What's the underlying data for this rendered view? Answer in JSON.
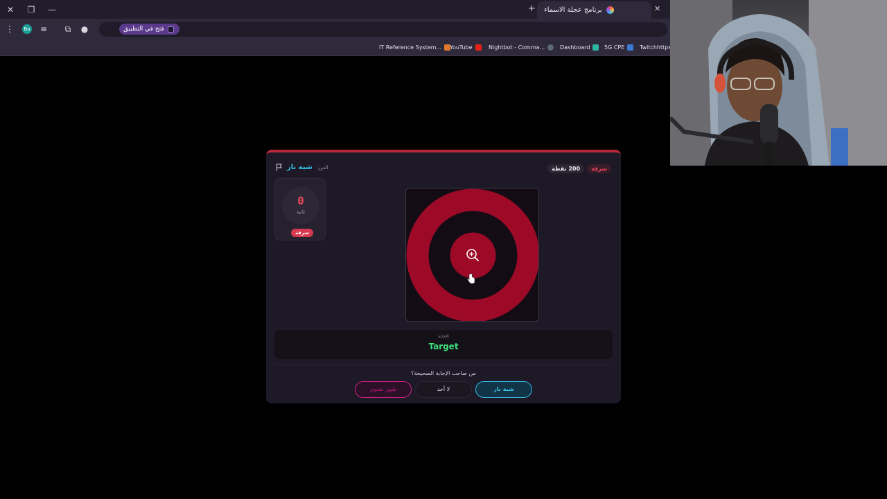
{
  "browser": {
    "tab_title": "برنامج عجلة الاسماء",
    "open_in_app_label": "فتح في التطبيق",
    "profile_initials": "Ba",
    "bookmarks": [
      {
        "label": "IT Reference System...",
        "color": "#e07a2e"
      },
      {
        "label": "YouTube",
        "color": "#e62117"
      },
      {
        "label": "Nightbot - Comma...",
        "color": "#5a6a7a"
      },
      {
        "label": "Dashboard",
        "color": "#2fb6a0"
      },
      {
        "label": "5G CPE",
        "color": "#3a7bd5"
      },
      {
        "label": "Twitchhttps:/",
        "color": "#9146ff"
      }
    ]
  },
  "game": {
    "turn_label": "الدور:",
    "player_name": "شبة نار",
    "badge_category": "سرقة",
    "badge_points": "200 نقطة",
    "timer_value": "0",
    "timer_unit": "ثانية",
    "timer_badge": "سرقة",
    "answer_label": "الإجابة",
    "answer_text": "Target",
    "question": "من صاحب الإجابة الصحيحة؟",
    "choices": {
      "team_pink": "طيور شتوي",
      "none": "لا أحد",
      "team_cyan": "شبة نار"
    },
    "colors": {
      "accent_red": "#b8283b",
      "team_cyan": "#35b8e0",
      "team_pink": "#d01f86",
      "answer_green": "#3ee07a"
    }
  }
}
